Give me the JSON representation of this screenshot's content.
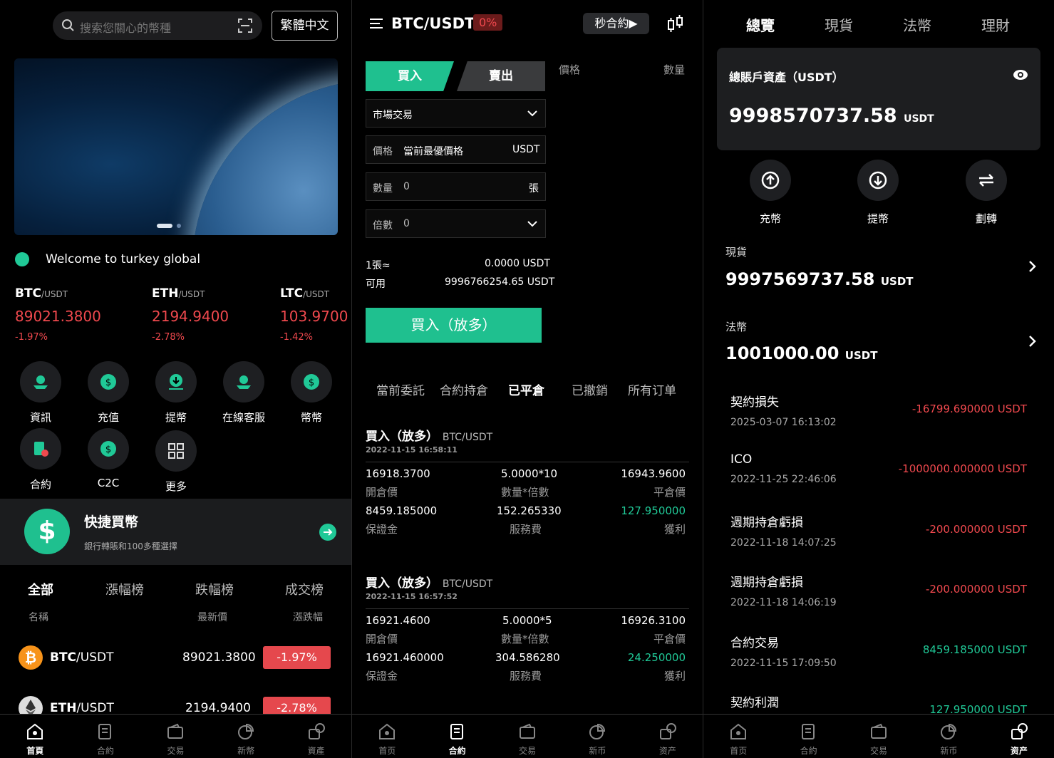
{
  "home": {
    "search_placeholder": "搜索您關心的幣種",
    "lang_button": "繁體中文",
    "welcome": "Welcome to turkey global",
    "tickers": [
      {
        "base": "BTC",
        "quote": "/USDT",
        "price": "89021.3800",
        "change": "-1.97%"
      },
      {
        "base": "ETH",
        "quote": "/USDT",
        "price": "2194.9400",
        "change": "-2.78%"
      },
      {
        "base": "LTC",
        "quote": "/USDT",
        "price": "103.9700",
        "change": "-1.42%"
      }
    ],
    "quick_items": [
      "資訊",
      "充值",
      "提幣",
      "在線客服",
      "幣幣",
      "合約",
      "C2C",
      "更多"
    ],
    "quickbuy": {
      "title": "快捷買幣",
      "subtitle": "銀行轉賬和100多種選擇"
    },
    "market_tabs": [
      "全部",
      "漲幅榜",
      "跌幅榜",
      "成交榜"
    ],
    "market_headers": {
      "name": "名稱",
      "price": "最新價",
      "change": "漲跌幅"
    },
    "market_rows": [
      {
        "base": "BTC",
        "quote": "/USDT",
        "price": "89021.3800",
        "change": "-1.97%"
      },
      {
        "base": "ETH",
        "quote": "/USDT",
        "price": "2194.9400",
        "change": "-2.78%"
      }
    ]
  },
  "nav1": [
    "首頁",
    "合約",
    "交易",
    "新幣",
    "資產"
  ],
  "contract": {
    "pair": "BTC/USDT",
    "pct": "0%",
    "mode_button": "秒合約▶",
    "buy_tab": "買入",
    "sell_tab": "賣出",
    "col_price": "價格",
    "col_qty": "數量",
    "order_type": "市場交易",
    "price_label": "價格",
    "price_value": "當前最優價格",
    "price_unit": "USDT",
    "qty_label": "數量",
    "qty_value": "0",
    "qty_unit": "張",
    "lev_label": "倍數",
    "lev_value": "0",
    "per_label": "1張≈",
    "per_value": "0.0000 USDT",
    "avail_label": "可用",
    "avail_value": "9996766254.65 USDT",
    "buy_button": "買入（放多）",
    "order_tabs": [
      "當前委託",
      "合約持倉",
      "已平倉",
      "已撤銷",
      "所有订单"
    ],
    "records": [
      {
        "title": "買入（放多）",
        "pair": "BTC/USDT",
        "time": "2022-11-15 16:58:11",
        "open": "16918.3700",
        "qtylev": "5.0000*10",
        "close": "16943.9600",
        "margin": "8459.185000",
        "fee": "152.265330",
        "profit": "127.950000"
      },
      {
        "title": "買入（放多）",
        "pair": "BTC/USDT",
        "time": "2022-11-15 16:57:52",
        "open": "16921.4600",
        "qtylev": "5.0000*5",
        "close": "16926.3100",
        "margin": "16921.460000",
        "fee": "304.586280",
        "profit": "24.250000"
      }
    ],
    "labels": {
      "open": "開倉價",
      "qtylev": "數量*倍數",
      "close": "平倉價",
      "margin": "保證金",
      "fee": "服務費",
      "profit": "獲利"
    }
  },
  "nav2": [
    "首页",
    "合約",
    "交易",
    "新币",
    "资产"
  ],
  "assets": {
    "tabs": [
      "總覽",
      "現貨",
      "法幣",
      "理財"
    ],
    "total_label": "總賬戶資產（USDT）",
    "total_value": "9998570737.58",
    "unit": "USDT",
    "actions": [
      "充幣",
      "提幣",
      "劃轉"
    ],
    "spot_label": "現貨",
    "spot_value": "9997569737.58",
    "fiat_label": "法幣",
    "fiat_value": "1001000.00",
    "history": [
      {
        "title": "契約損失",
        "date": "2025-03-07 16:13:02",
        "value": "-16799.690000 USDT"
      },
      {
        "title": "ICO",
        "date": "2022-11-25 22:46:06",
        "value": "-1000000.000000 USDT"
      },
      {
        "title": "週期持倉虧損",
        "date": "2022-11-18 14:07:25",
        "value": "-200.000000 USDT"
      },
      {
        "title": "週期持倉虧損",
        "date": "2022-11-18 14:06:19",
        "value": "-200.000000 USDT"
      },
      {
        "title": "合約交易",
        "date": "2022-11-15 17:09:50",
        "value": "8459.185000 USDT"
      },
      {
        "title": "契約利潤",
        "date": "",
        "value": "127.950000 USDT"
      }
    ]
  },
  "nav3": [
    "首页",
    "合約",
    "交易",
    "新币",
    "资产"
  ]
}
